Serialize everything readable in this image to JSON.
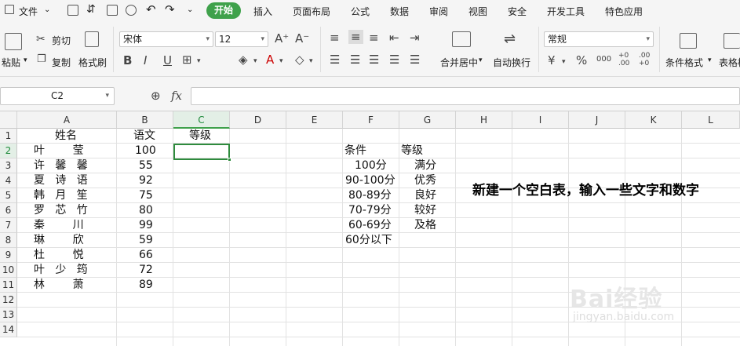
{
  "menubar": {
    "file_label": "文件",
    "tabs": [
      "开始",
      "插入",
      "页面布局",
      "公式",
      "数据",
      "审阅",
      "视图",
      "安全",
      "开发工具",
      "特色应用"
    ]
  },
  "ribbon": {
    "paste": "粘贴",
    "cut": "剪切",
    "copy": "复制",
    "format_painter": "格式刷",
    "font_name": "宋体",
    "font_size": "12",
    "bold": "B",
    "italic": "I",
    "underline": "U",
    "merge_center": "合并居中",
    "wrap_text": "自动换行",
    "number_format": "常规",
    "percent": "%",
    "thousands": "000",
    "inc_decimal": "+0 .00",
    "dec_decimal": ".00 +0",
    "conditional_format": "条件格式",
    "table_format": "表格样"
  },
  "formula_bar": {
    "name_box": "C2",
    "fx_label": "fx",
    "formula": ""
  },
  "grid": {
    "columns": [
      "A",
      "B",
      "C",
      "D",
      "E",
      "F",
      "G",
      "H",
      "I",
      "J",
      "K",
      "L"
    ],
    "selected_column": "C",
    "rows": [
      "1",
      "2",
      "3",
      "4",
      "5",
      "6",
      "7",
      "8",
      "9",
      "10",
      "11",
      "12",
      "13",
      "14"
    ],
    "selected_row": "2",
    "header_row": {
      "a": "姓名",
      "b": "语文",
      "c": "等级"
    },
    "names": [
      "叶        莹",
      "许   馨   馨",
      "夏   诗   语",
      "韩   月   笙",
      "罗   芯   竹",
      "秦        川",
      "琳        欣",
      "杜        悦",
      "叶   少   筠",
      "林        萧"
    ],
    "scores": [
      "100",
      "55",
      "92",
      "75",
      "80",
      "99",
      "59",
      "66",
      "72",
      "89"
    ],
    "criteria_header": {
      "f": "条件",
      "g": "等级"
    },
    "criteria": [
      {
        "range": "100分",
        "grade": "满分"
      },
      {
        "range": "90-100分",
        "grade": "优秀"
      },
      {
        "range": "80-89分",
        "grade": "良好"
      },
      {
        "range": "70-79分",
        "grade": "较好"
      },
      {
        "range": "60-69分",
        "grade": "及格"
      },
      {
        "range": "60分以下",
        "grade": ""
      }
    ],
    "note": "新建一个空白表，输入一些文字和数字"
  },
  "watermark": {
    "main": "Bai经验",
    "sub": "jingyan.baidu.com"
  },
  "colors": {
    "accent": "#3fa14b",
    "selection": "#2e8b3d"
  }
}
